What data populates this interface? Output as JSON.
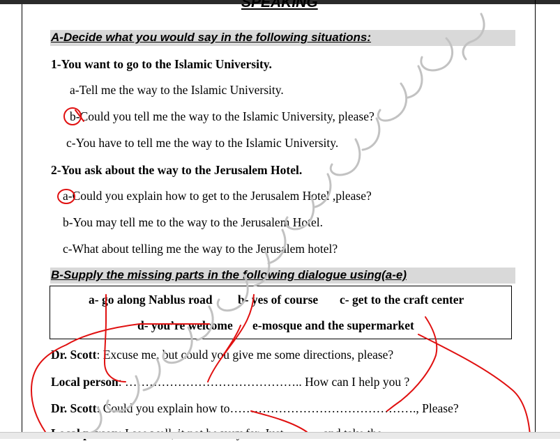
{
  "heading": "SPEAKING",
  "section_a": {
    "title": "A-Decide what you would  say in the following situations:",
    "q1": {
      "question": "1-You want to go to the Islamic University.",
      "options": [
        "a-Tell me the way to the Islamic University.",
        "b-Could you tell me the way to the Islamic University, please?",
        "c-You have to tell me the way to the Islamic University."
      ]
    },
    "q2": {
      "question": "2-You ask about the way to the Jerusalem Hotel.",
      "options": [
        "a-Could you explain  how  to get to the Jerusalem  Hotel ,please?",
        "b-You may tell me to the way to the Jerusalem Hotel.",
        "c-What about telling me the way to the Jerusalem hotel?"
      ]
    }
  },
  "section_b": {
    "title": "B-Supply the missing  parts in the following dialogue using(a-e)",
    "choices_row1": [
      "a- go along Nablus road",
      "b- yes of course",
      "c- get to the craft center"
    ],
    "choices_row2": [
      "d- you’re welcome",
      "e-mosque and the supermarket"
    ],
    "dialogue": [
      {
        "speaker": "Dr. Scott",
        "sep": ": ",
        "text": "Excuse me, but could you give me some directions, please?"
      },
      {
        "speaker": "Local person",
        "sep": ": ",
        "text": "…………………………………….. How can I help you ?"
      },
      {
        "speaker": "Dr. Scott",
        "sep": ": ",
        "text": "Could you  explain how to………………………………………., Please?"
      },
      {
        "speaker": "Local person",
        "sep": ": ",
        "text": "I see well, it not be very far. Just……                      …and take the"
      }
    ]
  },
  "colors": {
    "ink": "#e01010",
    "band": "#d9d9d9",
    "watermark": "#bdbdbd"
  }
}
